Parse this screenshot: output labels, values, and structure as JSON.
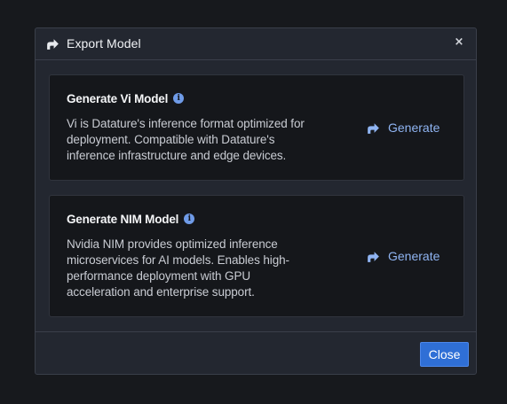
{
  "dialog": {
    "title": "Export Model",
    "header_icon": "export-arrow-icon",
    "close_icon": "close-icon",
    "close_glyph": "×"
  },
  "cards": [
    {
      "title": "Generate Vi Model",
      "info_icon": "info-icon",
      "description": "Vi is Datature's inference format optimized for deployment. Compatible with Datature's inference infrastructure and edge devices.",
      "action_label": "Generate",
      "action_icon": "export-arrow-icon"
    },
    {
      "title": "Generate NIM Model",
      "info_icon": "info-icon",
      "description": "Nvidia NIM provides optimized inference microservices for AI models. Enables high-performance deployment with GPU acceleration and enterprise support.",
      "action_label": "Generate",
      "action_icon": "export-arrow-icon"
    }
  ],
  "footer": {
    "close_label": "Close"
  },
  "colors": {
    "accent": "#2f6fd6",
    "link": "#8fb4f2",
    "info": "#6f9be8",
    "panel": "#232730",
    "card": "#15171b"
  }
}
